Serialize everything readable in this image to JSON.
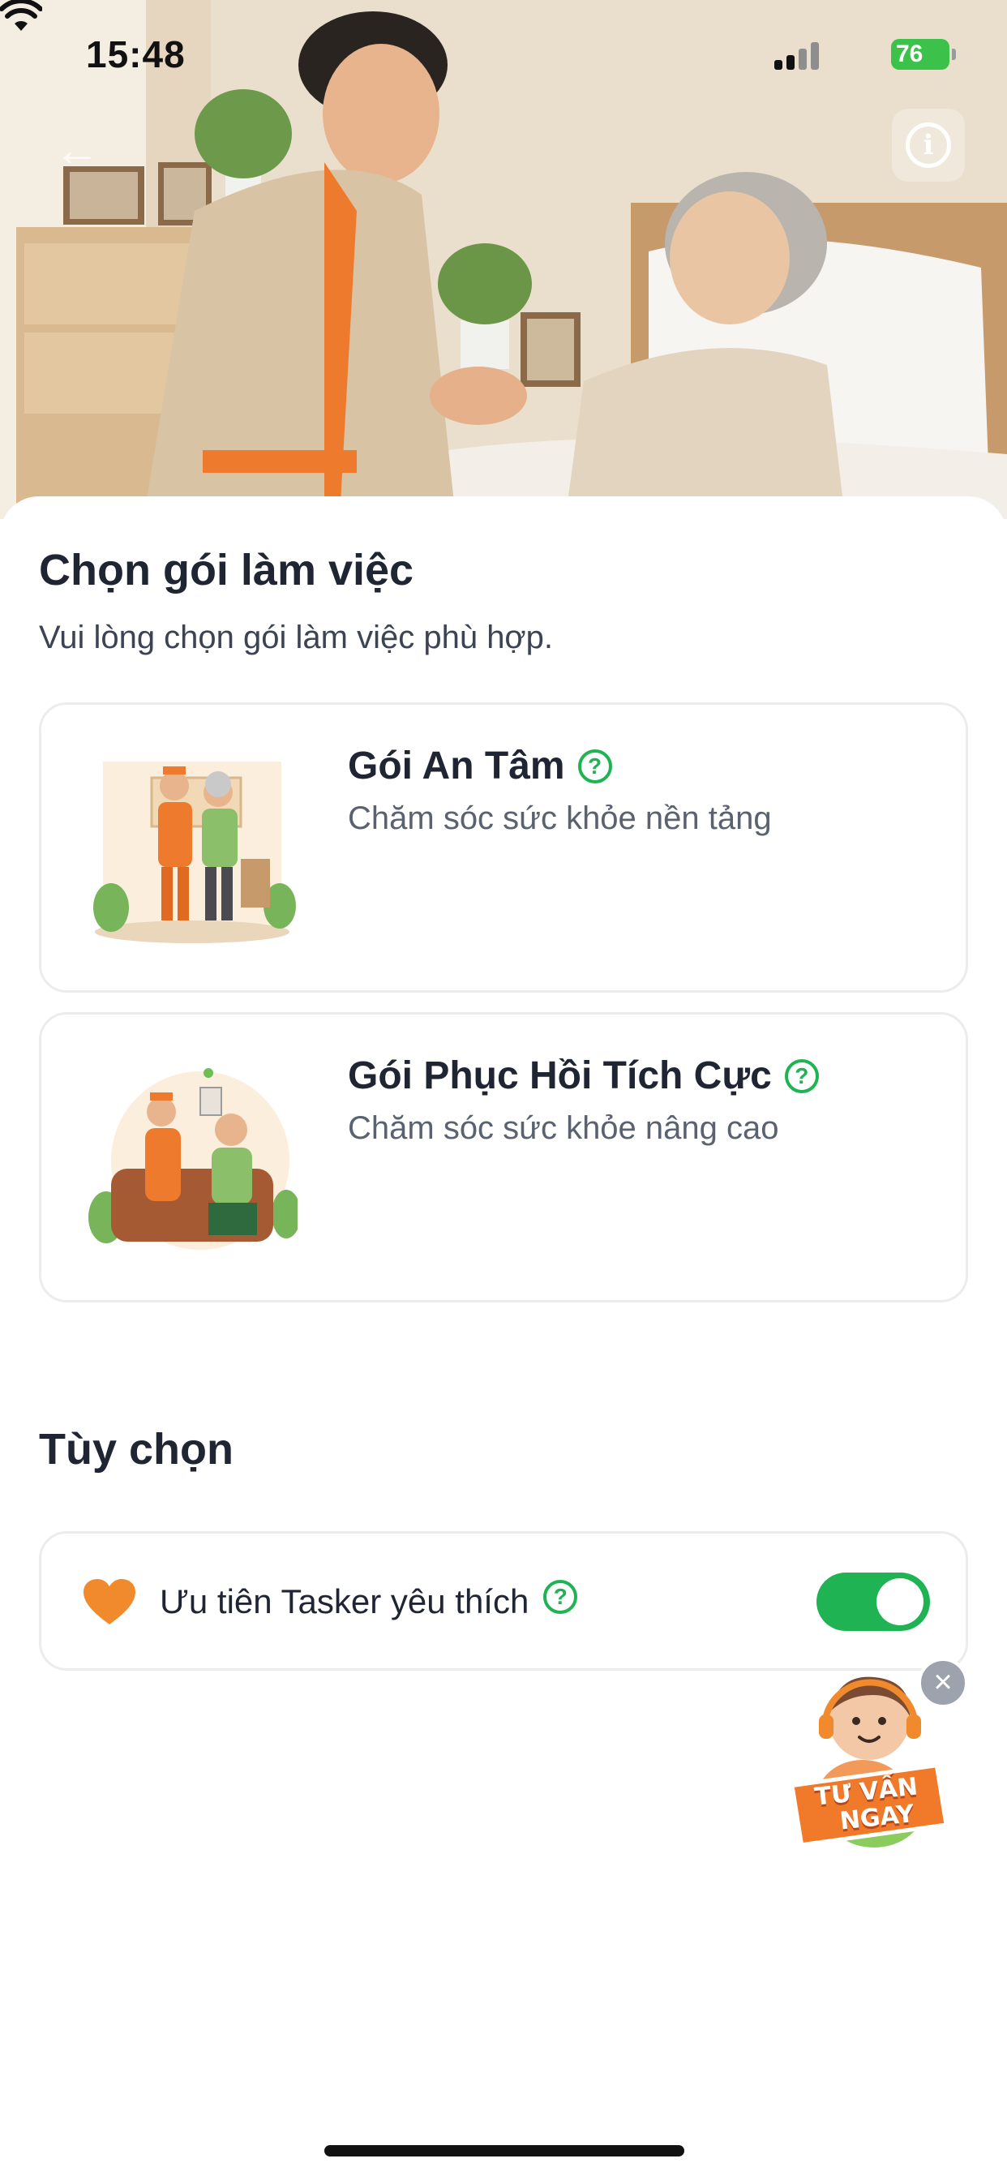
{
  "status_bar": {
    "time": "15:48",
    "battery": "76"
  },
  "header": {
    "back_icon": "arrow-left-icon",
    "info_icon": "info-icon",
    "hero_image": "caregiver holding hands of elderly woman in bed"
  },
  "page": {
    "title": "Chọn gói làm việc",
    "subtitle": "Vui lòng chọn gói làm việc phù hợp."
  },
  "packages": [
    {
      "name": "Gói An Tâm",
      "description": "Chăm sóc sức khỏe nền tảng"
    },
    {
      "name": "Gói Phục Hồi Tích Cực",
      "description": "Chăm sóc sức khỏe nâng cao"
    }
  ],
  "options": {
    "title": "Tùy chọn",
    "items": [
      {
        "label": "Ưu tiên Tasker yêu thích",
        "enabled": true
      }
    ]
  },
  "consult": {
    "line1": "TƯ VẤN",
    "line2": "NGAY"
  },
  "colors": {
    "accent_green": "#1fb354",
    "accent_orange": "#f08a2d",
    "text_dark": "#1f2533",
    "card_border": "#ececef"
  }
}
